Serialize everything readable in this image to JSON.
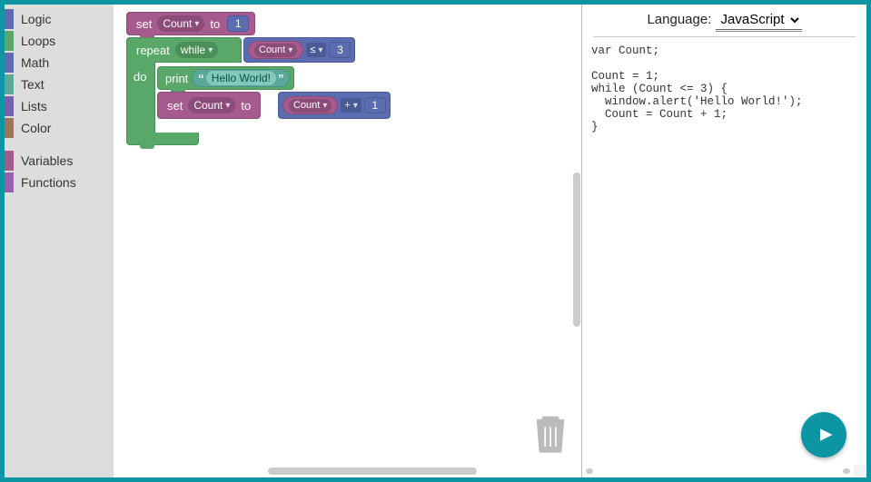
{
  "toolbox": {
    "items": [
      {
        "label": "Logic",
        "color": "#5b6db0"
      },
      {
        "label": "Loops",
        "color": "#5aa869"
      },
      {
        "label": "Math",
        "color": "#5b6db0"
      },
      {
        "label": "Text",
        "color": "#59a89a"
      },
      {
        "label": "Lists",
        "color": "#7a5fb0"
      },
      {
        "label": "Color",
        "color": "#a0745a"
      },
      {
        "label": "Variables",
        "color": "#a65b8e"
      },
      {
        "label": "Functions",
        "color": "#9a5fb0"
      }
    ]
  },
  "blocks": {
    "set1": {
      "set": "set",
      "var": "Count",
      "to": "to",
      "value": "1"
    },
    "repeat": {
      "repeat": "repeat",
      "mode": "while",
      "do": "do"
    },
    "cond": {
      "var": "Count",
      "op": "≤",
      "limit": "3"
    },
    "print": {
      "print": "print",
      "text": "Hello World!"
    },
    "set2": {
      "set": "set",
      "var": "Count",
      "to": "to"
    },
    "increment": {
      "var": "Count",
      "op": "+",
      "amount": "1"
    }
  },
  "code": {
    "language_label": "Language:",
    "language_value": "JavaScript",
    "body": "var Count;\n\nCount = 1;\nwhile (Count <= 3) {\n  window.alert('Hello World!');\n  Count = Count + 1;\n}"
  }
}
